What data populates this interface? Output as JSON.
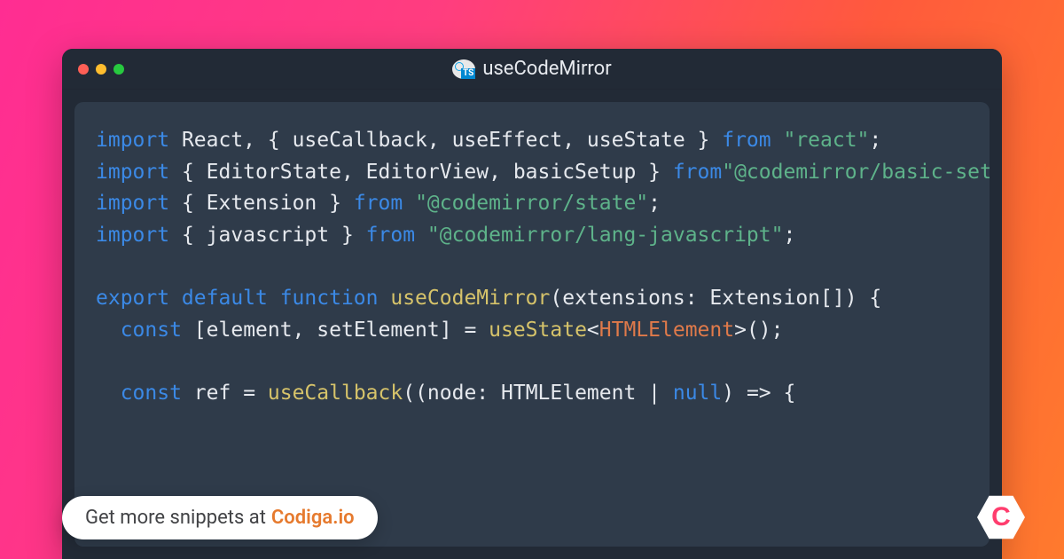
{
  "titlebar": {
    "title": "useCodeMirror",
    "icon_label": "TS"
  },
  "code_lines": [
    [
      {
        "c": "tok-kw",
        "t": "import"
      },
      {
        "c": "tok-pl",
        "t": " React, { useCallback, useEffect, useState } "
      },
      {
        "c": "tok-kw",
        "t": "from"
      },
      {
        "c": "tok-pl",
        "t": " "
      },
      {
        "c": "tok-str",
        "t": "\"react\""
      },
      {
        "c": "tok-pl",
        "t": ";"
      }
    ],
    [
      {
        "c": "tok-kw",
        "t": "import"
      },
      {
        "c": "tok-pl",
        "t": " { EditorState, EditorView, basicSetup } "
      },
      {
        "c": "tok-kw",
        "t": "from"
      },
      {
        "c": "tok-str",
        "t": "\"@codemirror/basic-setup\""
      }
    ],
    [
      {
        "c": "tok-kw",
        "t": "import"
      },
      {
        "c": "tok-pl",
        "t": " { Extension } "
      },
      {
        "c": "tok-kw",
        "t": "from"
      },
      {
        "c": "tok-pl",
        "t": " "
      },
      {
        "c": "tok-str",
        "t": "\"@codemirror/state\""
      },
      {
        "c": "tok-pl",
        "t": ";"
      }
    ],
    [
      {
        "c": "tok-kw",
        "t": "import"
      },
      {
        "c": "tok-pl",
        "t": " { javascript } "
      },
      {
        "c": "tok-kw",
        "t": "from"
      },
      {
        "c": "tok-pl",
        "t": " "
      },
      {
        "c": "tok-str",
        "t": "\"@codemirror/lang-javascript\""
      },
      {
        "c": "tok-pl",
        "t": ";"
      }
    ],
    [
      {
        "c": "tok-pl",
        "t": ""
      }
    ],
    [
      {
        "c": "tok-kw",
        "t": "export default function"
      },
      {
        "c": "tok-pl",
        "t": " "
      },
      {
        "c": "tok-fn",
        "t": "useCodeMirror"
      },
      {
        "c": "tok-pl",
        "t": "(extensions: Extension[]) {"
      }
    ],
    [
      {
        "c": "tok-pl",
        "t": "  "
      },
      {
        "c": "tok-kw",
        "t": "const"
      },
      {
        "c": "tok-pl",
        "t": " [element, setElement] = "
      },
      {
        "c": "tok-fn",
        "t": "useState"
      },
      {
        "c": "tok-pl",
        "t": "<"
      },
      {
        "c": "tok-typ",
        "t": "HTMLElement"
      },
      {
        "c": "tok-pl",
        "t": ">();"
      }
    ],
    [
      {
        "c": "tok-pl",
        "t": ""
      }
    ],
    [
      {
        "c": "tok-pl",
        "t": "  "
      },
      {
        "c": "tok-kw",
        "t": "const"
      },
      {
        "c": "tok-pl",
        "t": " ref = "
      },
      {
        "c": "tok-fn",
        "t": "useCallback"
      },
      {
        "c": "tok-pl",
        "t": "((node: HTMLElement | "
      },
      {
        "c": "tok-lit",
        "t": "null"
      },
      {
        "c": "tok-pl",
        "t": ") => {"
      }
    ]
  ],
  "promo": {
    "prefix": "Get more snippets at ",
    "brand": "Codiga.io"
  },
  "logo": {
    "letter": "C"
  }
}
